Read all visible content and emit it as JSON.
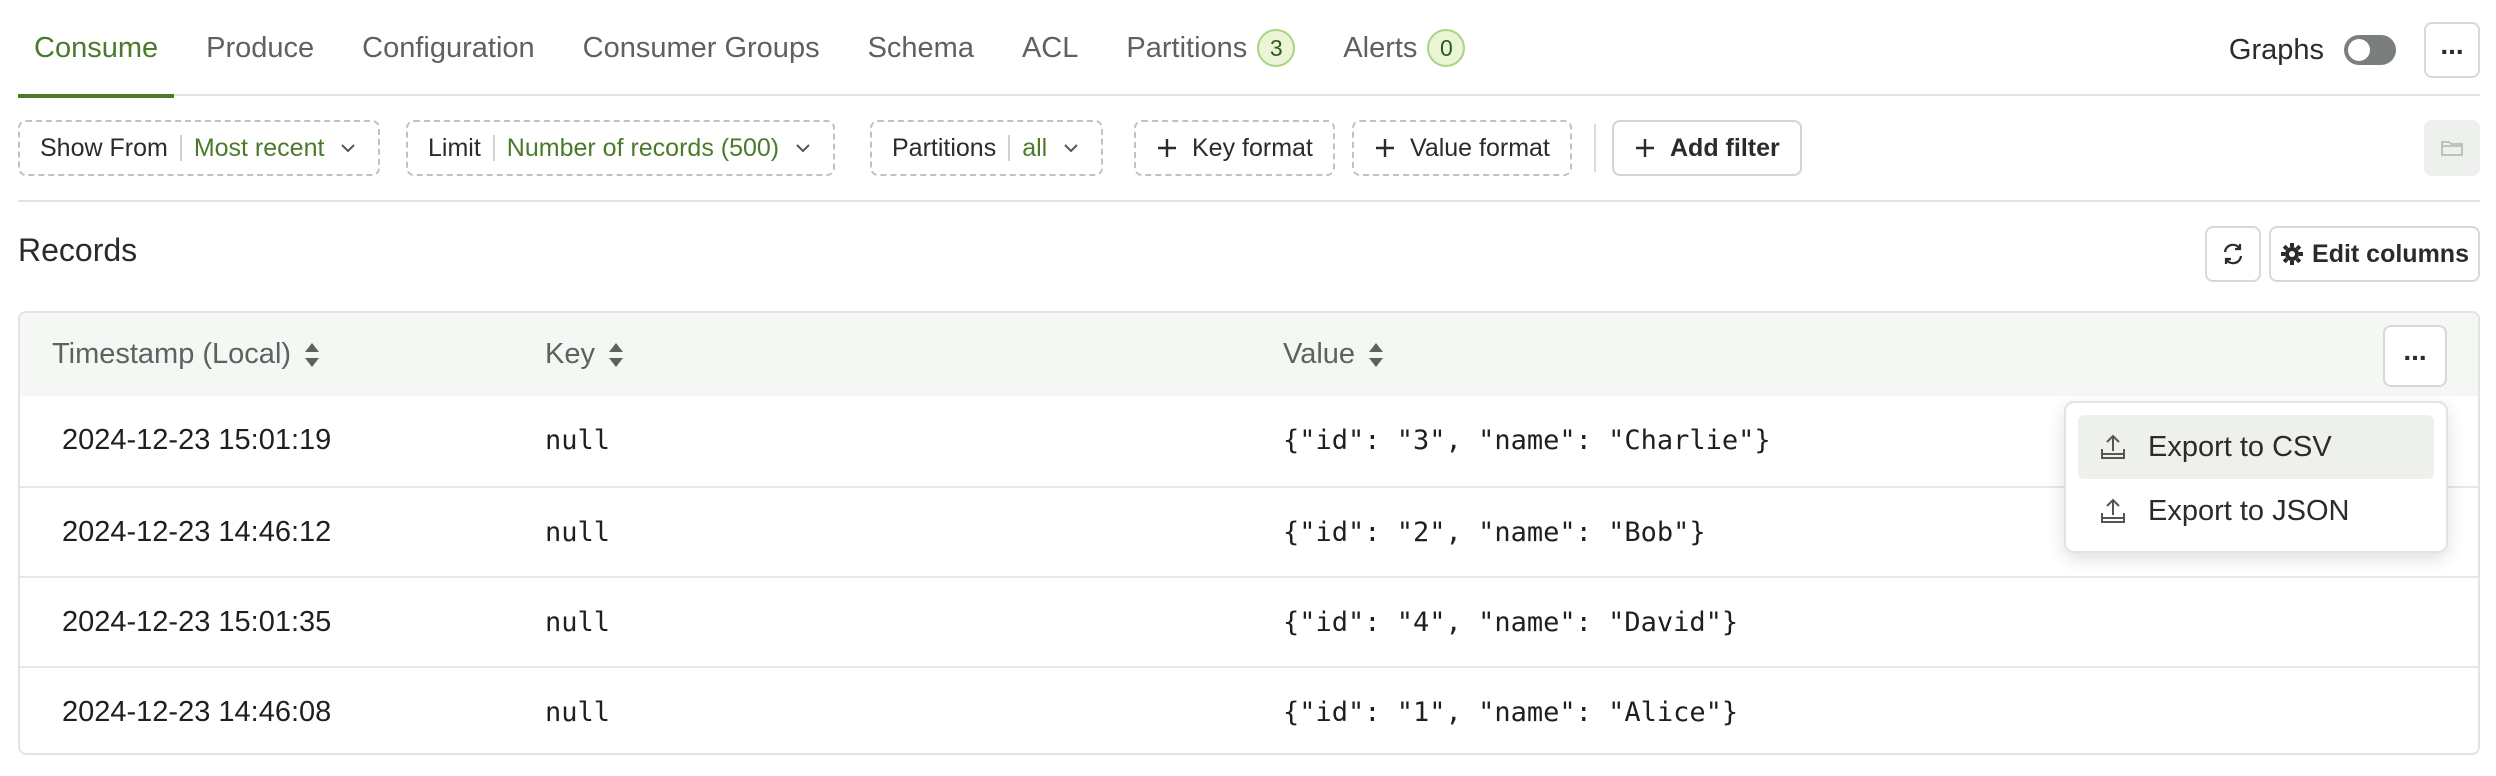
{
  "tabs": [
    {
      "label": "Consume",
      "active": true
    },
    {
      "label": "Produce"
    },
    {
      "label": "Configuration"
    },
    {
      "label": "Consumer Groups"
    },
    {
      "label": "Schema"
    },
    {
      "label": "ACL"
    },
    {
      "label": "Partitions",
      "badge": "3"
    },
    {
      "label": "Alerts",
      "badge": "0"
    }
  ],
  "graphs": {
    "label": "Graphs",
    "enabled": false
  },
  "header_menu_icon": "ellipsis-icon",
  "filters": {
    "show_from": {
      "label": "Show From",
      "value": "Most recent"
    },
    "limit": {
      "label": "Limit",
      "value": "Number of records (500)"
    },
    "partitions": {
      "label": "Partitions",
      "value": "all"
    },
    "key_format": "Key format",
    "value_format": "Value format",
    "add_filter": "Add filter"
  },
  "records": {
    "title": "Records",
    "edit_columns": "Edit columns",
    "columns": [
      "Timestamp (Local)",
      "Key",
      "Value"
    ],
    "rows": [
      {
        "timestamp": "2024-12-23 15:01:19",
        "key": "null",
        "value": "{\"id\": \"3\", \"name\": \"Charlie\"}"
      },
      {
        "timestamp": "2024-12-23 14:46:12",
        "key": "null",
        "value": "{\"id\": \"2\", \"name\": \"Bob\"}"
      },
      {
        "timestamp": "2024-12-23 15:01:35",
        "key": "null",
        "value": "{\"id\": \"4\", \"name\": \"David\"}"
      },
      {
        "timestamp": "2024-12-23 14:46:08",
        "key": "null",
        "value": "{\"id\": \"1\", \"name\": \"Alice\"}"
      }
    ]
  },
  "export_menu": {
    "items": [
      {
        "label": "Export to CSV",
        "icon": "upload-icon"
      },
      {
        "label": "Export to JSON",
        "icon": "upload-icon"
      }
    ]
  },
  "colors": {
    "accent": "#4a7a2c",
    "badge_bg": "#eaf5d8",
    "badge_border": "#a9d57e"
  }
}
